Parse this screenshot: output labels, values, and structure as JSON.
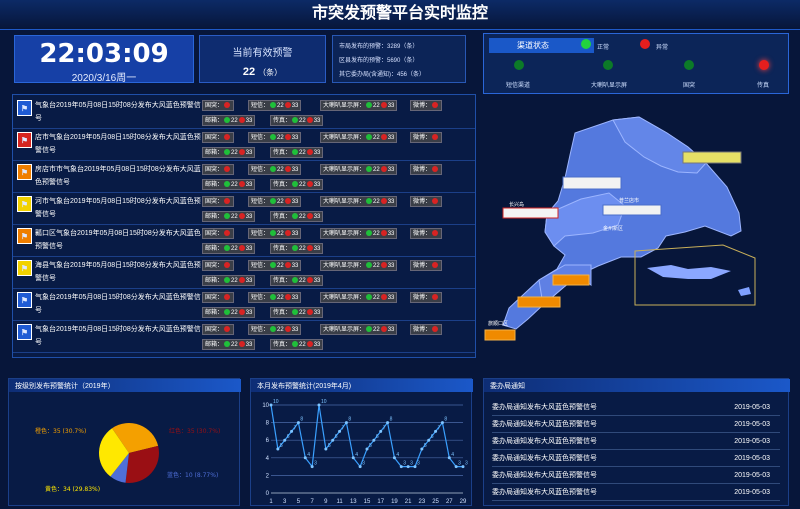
{
  "title": "市突发预警平台实时监控",
  "clock": {
    "time": "22:03:09",
    "date": "2020/3/16周一"
  },
  "warning": {
    "label": "当前有效预警",
    "count": "22",
    "unit": "（条）"
  },
  "stats": [
    "市局发布的预警：3289（条）",
    "区县发布的预警：5690（条）",
    "其它委办局(含通知)：456（条）"
  ],
  "channel": {
    "title": "渠道状态",
    "legend_ok": "正常",
    "legend_err": "异常",
    "items": [
      {
        "label": "短信渠道",
        "status": "ok"
      },
      {
        "label": "大喇叭显示屏",
        "status": "ok"
      },
      {
        "label": "国突",
        "status": "ok"
      },
      {
        "label": "传真",
        "status": "err"
      }
    ]
  },
  "alerts": [
    {
      "icon": "blue-wind",
      "text": "气象台2019年05月08日15时08分发布大风蓝色预警信号"
    },
    {
      "icon": "red-heat",
      "text": "店市气象台2019年05月08日15时08分发布大风蓝色预警信号"
    },
    {
      "icon": "orange-fire",
      "text": "房店市市气象台2019年05月08日15时08分发布大风蓝色预警信号"
    },
    {
      "icon": "yellow-wave",
      "text": "河市气象台2019年05月08日15时08分发布大风蓝色预警信号"
    },
    {
      "icon": "orange-rain",
      "text": "瓤口区气象台2019年05月08日15时08分发布大风蓝色预警信号"
    },
    {
      "icon": "yellow-storm",
      "text": "海县气象台2019年05月08日15时08分发布大风蓝色预警信号"
    },
    {
      "icon": "blue-snow",
      "text": "气象台2019年05月08日15时08分发布大风蓝色预警信号"
    },
    {
      "icon": "blue-gale",
      "text": "气象台2019年05月08日15时08分发布大风蓝色预警信号"
    }
  ],
  "chips": {
    "guotu": "国突：",
    "sms": "短信：",
    "speaker": "大喇叭显示屏：",
    "weibo": "微博：",
    "mail": "邮箱：",
    "fax": "传真：",
    "val1": "22",
    "val2": "33"
  },
  "map_labels": [
    "长兴岛",
    "普兰店市",
    "金州新区",
    "旅顺口区"
  ],
  "sections": {
    "level": "按级别发布预警统计（2019年）",
    "count": "本月发布预警统计(2019年4月)",
    "notice": "委办局通知"
  },
  "chart_data": [
    {
      "type": "pie",
      "labels": [
        "橙色：35 (30.7%)",
        "红色：35 (30.7%)",
        "蓝色：10 (8.77%)",
        "黄色：34 (29.83%)"
      ],
      "series": [
        {
          "values": [
            35,
            35,
            10,
            34
          ]
        }
      ],
      "colors": [
        "#f4a000",
        "#9a0f14",
        "#4f6fd8",
        "#ffe800"
      ]
    },
    {
      "type": "line",
      "x": [
        1,
        2,
        3,
        4,
        5,
        6,
        7,
        8,
        9,
        10,
        11,
        12,
        13,
        14,
        15,
        16,
        17,
        18,
        19,
        20,
        21,
        22,
        23,
        24,
        25,
        26,
        27,
        28,
        29
      ],
      "xticks": [
        1,
        3,
        5,
        7,
        9,
        11,
        13,
        15,
        17,
        19,
        21,
        23,
        25,
        27,
        29
      ],
      "yticks": [
        0,
        2,
        4,
        6,
        8,
        10
      ],
      "values": [
        10,
        5,
        6,
        7,
        8,
        4,
        3,
        10,
        5,
        6,
        7,
        8,
        4,
        3,
        5,
        6,
        7,
        8,
        4,
        3,
        3,
        3,
        5,
        6,
        7,
        8,
        4,
        3,
        3
      ],
      "ylim": [
        0,
        10
      ]
    }
  ],
  "notices": [
    {
      "text": "委办局通知发布大风蓝色预警信号",
      "date": "2019-05-03"
    },
    {
      "text": "委办局通知发布大风蓝色预警信号",
      "date": "2019-05-03"
    },
    {
      "text": "委办局通知发布大风蓝色预警信号",
      "date": "2019-05-03"
    },
    {
      "text": "委办局通知发布大风蓝色预警信号",
      "date": "2019-05-03"
    },
    {
      "text": "委办局通知发布大风蓝色预警信号",
      "date": "2019-05-03"
    },
    {
      "text": "委办局通知发布大风蓝色预警信号",
      "date": "2019-05-03"
    }
  ]
}
